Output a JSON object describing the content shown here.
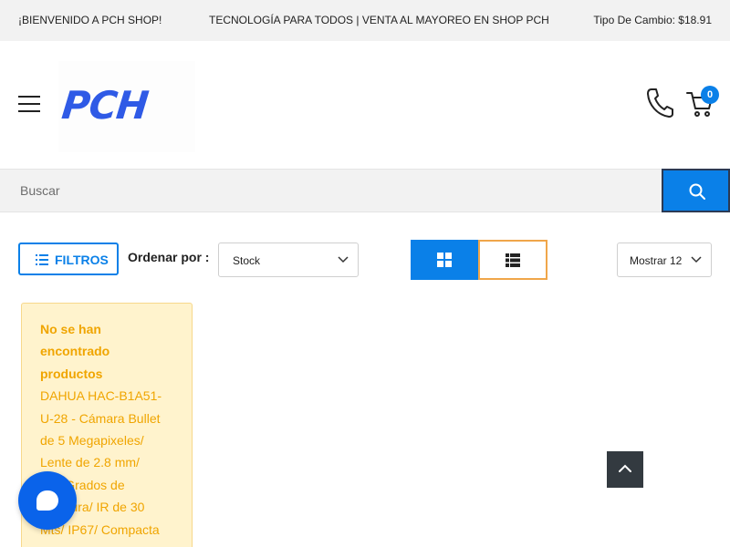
{
  "topbar": {
    "welcome": "¡BIENVENIDO A PCH SHOP!",
    "tagline": "TECNOLOGÍA PARA TODOS | VENTA AL MAYOREO EN SHOP PCH",
    "exchange_rate": "Tipo De Cambio: $18.91"
  },
  "header": {
    "logo": "PCH",
    "cart_count": "0"
  },
  "search": {
    "placeholder": "Buscar"
  },
  "toolbar": {
    "filters_label": "FILTROS",
    "sort_label": "Ordenar por :",
    "sort_value": "Stock",
    "show_value": "Mostrar 12",
    "active_view": "grid"
  },
  "notice": {
    "title": "No se han encontrado productos",
    "product": "DAHUA HAC-B1A51-U-28 - Cámara Bullet de 5 Megapixeles/ Lente de 2.8 mm/ 106 Grados de Apertura/ IR de 30 Mts/ IP67/ Compacta"
  },
  "colors": {
    "accent": "#0a80e8",
    "logo": "#2f5ae6",
    "notice_bg": "#fff3cd",
    "notice_text": "#f0a500",
    "list_view_border": "#f0a64a",
    "chat_button": "#0a63ea",
    "scroll_top_button": "#333a40"
  },
  "icons": {
    "menu": "hamburger-icon",
    "phone": "phone-icon",
    "cart": "shopping-cart-icon",
    "search": "search-icon",
    "filters": "list-icon",
    "sort_chevron": "chevron-down-icon",
    "grid_view": "grid-icon",
    "list_view": "list-view-icon",
    "chat": "chat-bubble-icon",
    "scroll_top": "chevron-up-icon"
  }
}
